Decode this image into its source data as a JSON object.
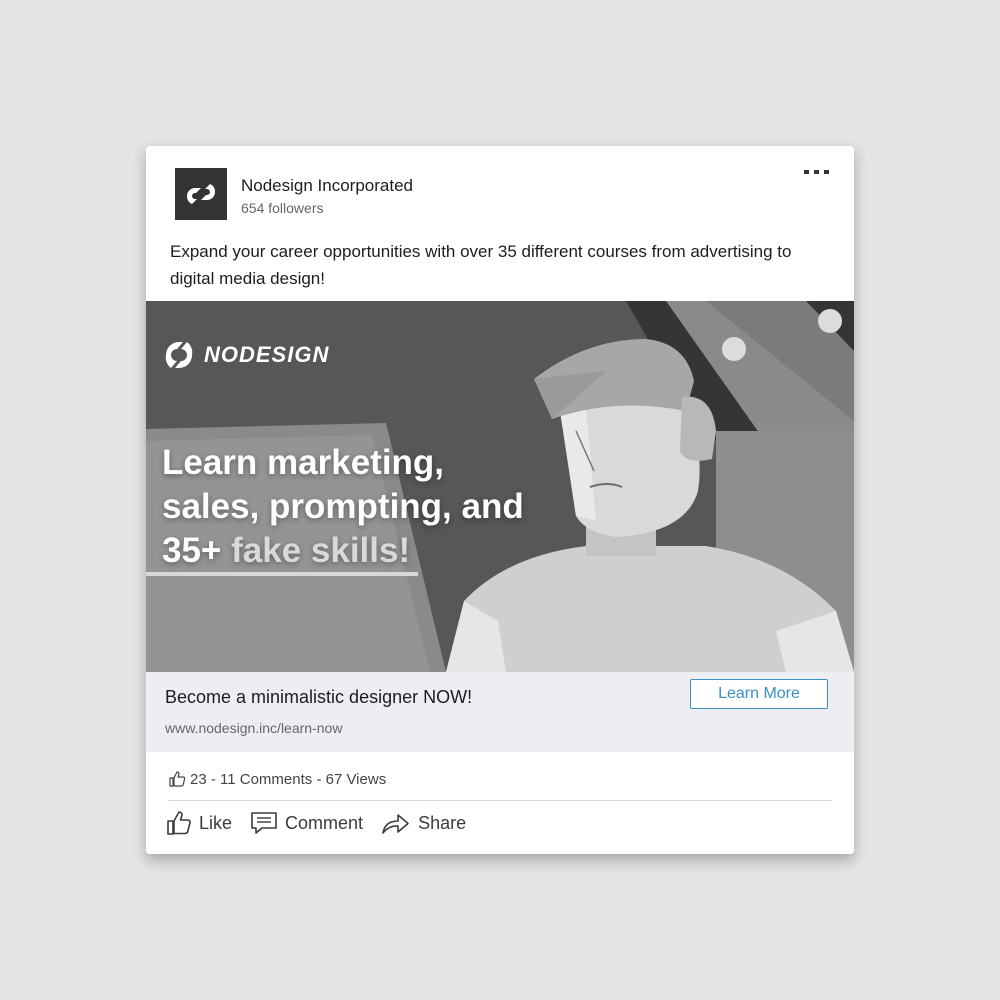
{
  "post": {
    "company_name": "Nodesign Incorporated",
    "followers": "654 followers",
    "text": "Expand your career opportunities with over 35 different courses from advertising to digital media design!"
  },
  "banner": {
    "brand_word": "NODESIGN",
    "headline_line1": "Learn marketing,",
    "headline_line2": "sales, prompting, and",
    "headline_line3_a": "35+ ",
    "headline_line3_b": "fake skills!"
  },
  "cta": {
    "title": "Become a minimalistic designer NOW!",
    "url": "www.nodesign.inc/learn-now",
    "button_label": "Learn More"
  },
  "stats": {
    "text": "23 - 11 Comments - 67 Views"
  },
  "actions": {
    "like_label": "Like",
    "comment_label": "Comment",
    "share_label": "Share"
  },
  "colors": {
    "accent": "#3a8fc4",
    "cta_background": "#eceef3",
    "page_background": "#e4e4e4"
  },
  "icons": [
    "logo-mark",
    "more-icon",
    "like-icon",
    "comment-icon",
    "share-icon"
  ]
}
